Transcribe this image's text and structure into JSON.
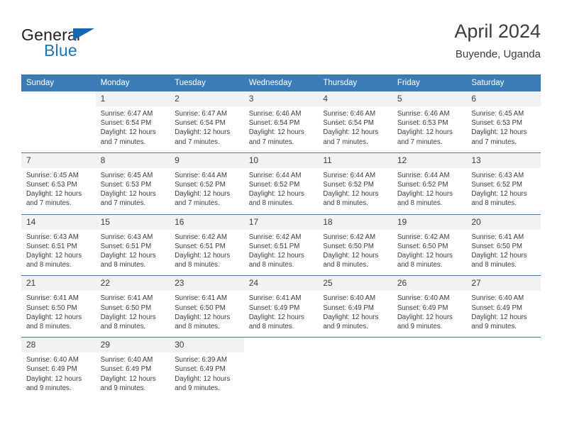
{
  "logo": {
    "word_one": "General",
    "word_two": "Blue",
    "triangle_icon": "triangle-icon",
    "brand_blue": "#1b75bc"
  },
  "header": {
    "title": "April 2024",
    "subtitle": "Buyende, Uganda"
  },
  "colors": {
    "header_bar": "#3b7cb8",
    "daynum_bg": "#f2f2f2",
    "text": "#3c3c3c"
  },
  "calendar": {
    "weekday_headers": [
      "Sunday",
      "Monday",
      "Tuesday",
      "Wednesday",
      "Thursday",
      "Friday",
      "Saturday"
    ],
    "weeks": [
      [
        {
          "day": "",
          "lines": []
        },
        {
          "day": "1",
          "lines": [
            "Sunrise: 6:47 AM",
            "Sunset: 6:54 PM",
            "Daylight: 12 hours",
            "and 7 minutes."
          ]
        },
        {
          "day": "2",
          "lines": [
            "Sunrise: 6:47 AM",
            "Sunset: 6:54 PM",
            "Daylight: 12 hours",
            "and 7 minutes."
          ]
        },
        {
          "day": "3",
          "lines": [
            "Sunrise: 6:46 AM",
            "Sunset: 6:54 PM",
            "Daylight: 12 hours",
            "and 7 minutes."
          ]
        },
        {
          "day": "4",
          "lines": [
            "Sunrise: 6:46 AM",
            "Sunset: 6:54 PM",
            "Daylight: 12 hours",
            "and 7 minutes."
          ]
        },
        {
          "day": "5",
          "lines": [
            "Sunrise: 6:46 AM",
            "Sunset: 6:53 PM",
            "Daylight: 12 hours",
            "and 7 minutes."
          ]
        },
        {
          "day": "6",
          "lines": [
            "Sunrise: 6:45 AM",
            "Sunset: 6:53 PM",
            "Daylight: 12 hours",
            "and 7 minutes."
          ]
        }
      ],
      [
        {
          "day": "7",
          "lines": [
            "Sunrise: 6:45 AM",
            "Sunset: 6:53 PM",
            "Daylight: 12 hours",
            "and 7 minutes."
          ]
        },
        {
          "day": "8",
          "lines": [
            "Sunrise: 6:45 AM",
            "Sunset: 6:53 PM",
            "Daylight: 12 hours",
            "and 7 minutes."
          ]
        },
        {
          "day": "9",
          "lines": [
            "Sunrise: 6:44 AM",
            "Sunset: 6:52 PM",
            "Daylight: 12 hours",
            "and 7 minutes."
          ]
        },
        {
          "day": "10",
          "lines": [
            "Sunrise: 6:44 AM",
            "Sunset: 6:52 PM",
            "Daylight: 12 hours",
            "and 8 minutes."
          ]
        },
        {
          "day": "11",
          "lines": [
            "Sunrise: 6:44 AM",
            "Sunset: 6:52 PM",
            "Daylight: 12 hours",
            "and 8 minutes."
          ]
        },
        {
          "day": "12",
          "lines": [
            "Sunrise: 6:44 AM",
            "Sunset: 6:52 PM",
            "Daylight: 12 hours",
            "and 8 minutes."
          ]
        },
        {
          "day": "13",
          "lines": [
            "Sunrise: 6:43 AM",
            "Sunset: 6:52 PM",
            "Daylight: 12 hours",
            "and 8 minutes."
          ]
        }
      ],
      [
        {
          "day": "14",
          "lines": [
            "Sunrise: 6:43 AM",
            "Sunset: 6:51 PM",
            "Daylight: 12 hours",
            "and 8 minutes."
          ]
        },
        {
          "day": "15",
          "lines": [
            "Sunrise: 6:43 AM",
            "Sunset: 6:51 PM",
            "Daylight: 12 hours",
            "and 8 minutes."
          ]
        },
        {
          "day": "16",
          "lines": [
            "Sunrise: 6:42 AM",
            "Sunset: 6:51 PM",
            "Daylight: 12 hours",
            "and 8 minutes."
          ]
        },
        {
          "day": "17",
          "lines": [
            "Sunrise: 6:42 AM",
            "Sunset: 6:51 PM",
            "Daylight: 12 hours",
            "and 8 minutes."
          ]
        },
        {
          "day": "18",
          "lines": [
            "Sunrise: 6:42 AM",
            "Sunset: 6:50 PM",
            "Daylight: 12 hours",
            "and 8 minutes."
          ]
        },
        {
          "day": "19",
          "lines": [
            "Sunrise: 6:42 AM",
            "Sunset: 6:50 PM",
            "Daylight: 12 hours",
            "and 8 minutes."
          ]
        },
        {
          "day": "20",
          "lines": [
            "Sunrise: 6:41 AM",
            "Sunset: 6:50 PM",
            "Daylight: 12 hours",
            "and 8 minutes."
          ]
        }
      ],
      [
        {
          "day": "21",
          "lines": [
            "Sunrise: 6:41 AM",
            "Sunset: 6:50 PM",
            "Daylight: 12 hours",
            "and 8 minutes."
          ]
        },
        {
          "day": "22",
          "lines": [
            "Sunrise: 6:41 AM",
            "Sunset: 6:50 PM",
            "Daylight: 12 hours",
            "and 8 minutes."
          ]
        },
        {
          "day": "23",
          "lines": [
            "Sunrise: 6:41 AM",
            "Sunset: 6:50 PM",
            "Daylight: 12 hours",
            "and 8 minutes."
          ]
        },
        {
          "day": "24",
          "lines": [
            "Sunrise: 6:41 AM",
            "Sunset: 6:49 PM",
            "Daylight: 12 hours",
            "and 8 minutes."
          ]
        },
        {
          "day": "25",
          "lines": [
            "Sunrise: 6:40 AM",
            "Sunset: 6:49 PM",
            "Daylight: 12 hours",
            "and 9 minutes."
          ]
        },
        {
          "day": "26",
          "lines": [
            "Sunrise: 6:40 AM",
            "Sunset: 6:49 PM",
            "Daylight: 12 hours",
            "and 9 minutes."
          ]
        },
        {
          "day": "27",
          "lines": [
            "Sunrise: 6:40 AM",
            "Sunset: 6:49 PM",
            "Daylight: 12 hours",
            "and 9 minutes."
          ]
        }
      ],
      [
        {
          "day": "28",
          "lines": [
            "Sunrise: 6:40 AM",
            "Sunset: 6:49 PM",
            "Daylight: 12 hours",
            "and 9 minutes."
          ]
        },
        {
          "day": "29",
          "lines": [
            "Sunrise: 6:40 AM",
            "Sunset: 6:49 PM",
            "Daylight: 12 hours",
            "and 9 minutes."
          ]
        },
        {
          "day": "30",
          "lines": [
            "Sunrise: 6:39 AM",
            "Sunset: 6:49 PM",
            "Daylight: 12 hours",
            "and 9 minutes."
          ]
        },
        {
          "day": "",
          "lines": []
        },
        {
          "day": "",
          "lines": []
        },
        {
          "day": "",
          "lines": []
        },
        {
          "day": "",
          "lines": []
        }
      ]
    ]
  }
}
